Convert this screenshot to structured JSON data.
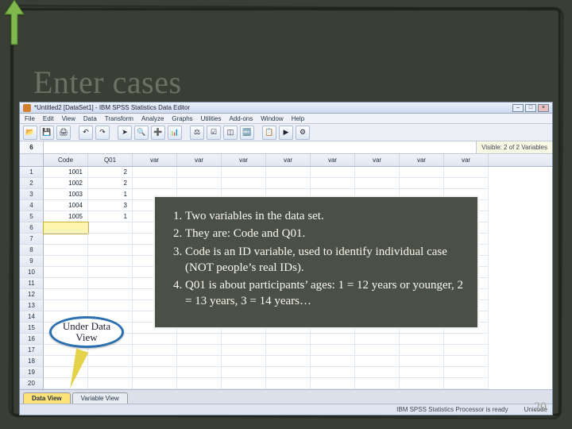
{
  "slide": {
    "title": "Enter cases",
    "page_number": "20"
  },
  "spss": {
    "window_title": "*Untitled2 [DataSet1] - IBM SPSS Statistics Data Editor",
    "menu": [
      "File",
      "Edit",
      "View",
      "Data",
      "Transform",
      "Analyze",
      "Graphs",
      "Utilities",
      "Add-ons",
      "Window",
      "Help"
    ],
    "toolbar_icons": [
      "open-icon",
      "save-icon",
      "print-icon",
      "undo-icon",
      "redo-icon",
      "goto-icon",
      "find-icon",
      "insert-icon",
      "chart-icon",
      "weight-icon",
      "select-icon",
      "split-icon",
      "value-labels-icon",
      "vars-icon",
      "run-icon",
      "options-icon"
    ],
    "active_cell_ref": "6",
    "active_cell_value": "",
    "visible_vars": "Visible: 2 of 2 Variables",
    "columns": [
      "Code",
      "Q01",
      "var",
      "var",
      "var",
      "var",
      "var",
      "var",
      "var",
      "var"
    ],
    "rows": [
      {
        "n": "1",
        "Code": "1001",
        "Q01": "2"
      },
      {
        "n": "2",
        "Code": "1002",
        "Q01": "2"
      },
      {
        "n": "3",
        "Code": "1003",
        "Q01": "1"
      },
      {
        "n": "4",
        "Code": "1004",
        "Q01": "3"
      },
      {
        "n": "5",
        "Code": "1005",
        "Q01": "1"
      },
      {
        "n": "6"
      },
      {
        "n": "7"
      },
      {
        "n": "8"
      },
      {
        "n": "9"
      },
      {
        "n": "10"
      },
      {
        "n": "11"
      },
      {
        "n": "12"
      },
      {
        "n": "13"
      },
      {
        "n": "14"
      },
      {
        "n": "15"
      },
      {
        "n": "16"
      },
      {
        "n": "17"
      },
      {
        "n": "18"
      },
      {
        "n": "19"
      },
      {
        "n": "20"
      }
    ],
    "tabs": {
      "data_view": "Data View",
      "variable_view": "Variable View"
    },
    "status": {
      "processor": "IBM SPSS Statistics Processor is ready",
      "unicode": "Unicode"
    }
  },
  "notes": {
    "items": [
      "Two variables in the data set.",
      "They are: Code and Q01.",
      "Code is an ID variable, used to identify individual case (NOT people’s real IDs).",
      "Q01 is about participants’ ages: 1 = 12 years or younger, 2 = 13 years, 3 = 14 years…"
    ]
  },
  "bubble": {
    "text": "Under Data View"
  }
}
